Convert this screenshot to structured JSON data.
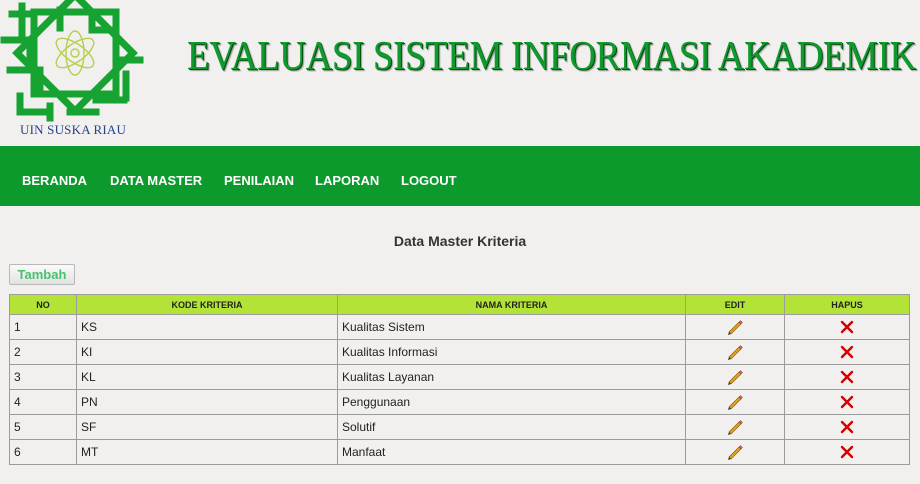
{
  "header": {
    "logo_caption": "UIN SUSKA RIAU",
    "site_title": "EVALUASI SISTEM INFORMASI AKADEMIK"
  },
  "nav": {
    "items": [
      {
        "label": "BERANDA"
      },
      {
        "label": "DATA MASTER"
      },
      {
        "label": "PENILAIAN"
      },
      {
        "label": "LAPORAN"
      },
      {
        "label": "LOGOUT"
      }
    ]
  },
  "main": {
    "heading": "Data Master Kriteria",
    "add_label": "Tambah",
    "table": {
      "columns": [
        "NO",
        "KODE KRITERIA",
        "NAMA KRITERIA",
        "EDIT",
        "HAPUS"
      ],
      "rows": [
        {
          "no": "1",
          "kode": "KS",
          "nama": "Kualitas Sistem"
        },
        {
          "no": "2",
          "kode": "KI",
          "nama": "Kualitas Informasi"
        },
        {
          "no": "3",
          "kode": "KL",
          "nama": "Kualitas Layanan"
        },
        {
          "no": "4",
          "kode": "PN",
          "nama": "Penggunaan"
        },
        {
          "no": "5",
          "kode": "SF",
          "nama": "Solutif"
        },
        {
          "no": "6",
          "kode": "MT",
          "nama": "Manfaat"
        }
      ]
    }
  },
  "icons": {
    "logo": "uin-suska-logo",
    "edit": "pencil-icon",
    "delete": "red-x-icon"
  },
  "colors": {
    "brand_green": "#0c9a2d",
    "header_row": "#b3e337",
    "delete_red": "#d40000"
  }
}
